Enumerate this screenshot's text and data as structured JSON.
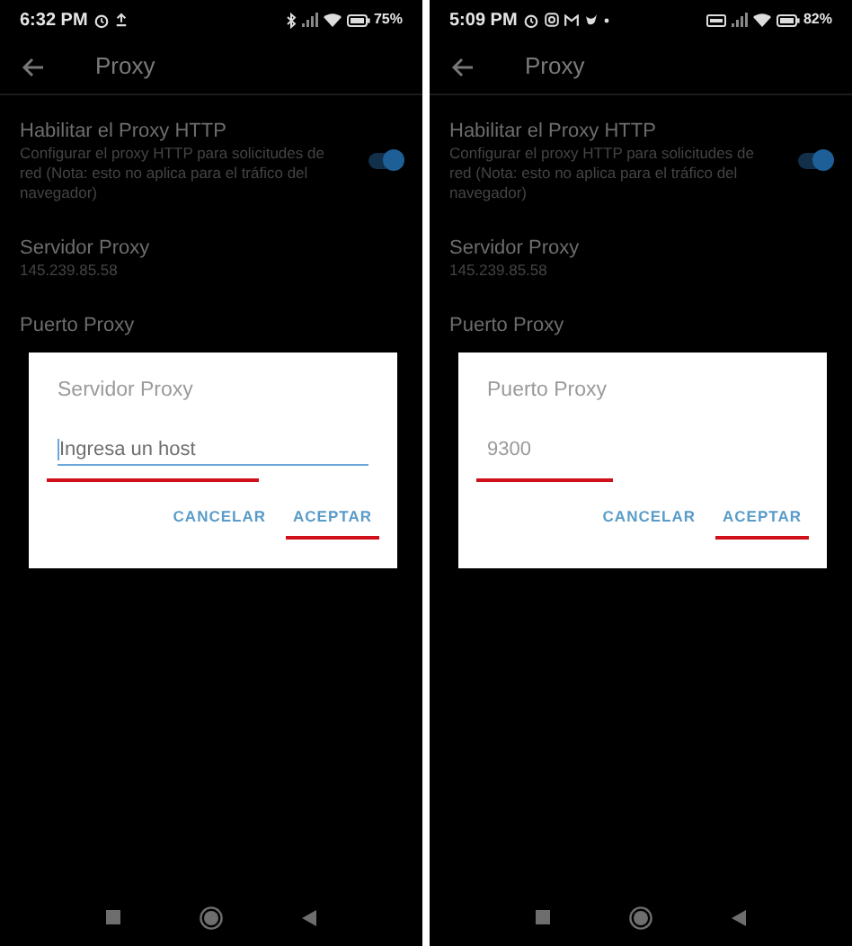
{
  "phones": [
    {
      "status_bar": {
        "time": "6:32 PM",
        "battery": "75%"
      },
      "app_bar": {
        "title": "Proxy"
      },
      "settings": [
        {
          "kind": "switch",
          "title": "Habilitar el Proxy HTTP",
          "summary": "Configurar el proxy HTTP para solicitudes de red (Nota: esto no aplica para el tráfico del navegador)",
          "on": true
        },
        {
          "kind": "text",
          "title": "Servidor Proxy",
          "summary": "145.239.85.58"
        },
        {
          "kind": "text",
          "title": "Puerto Proxy"
        }
      ],
      "dialog": {
        "title": "Servidor Proxy",
        "field": {
          "placeholder": "Ingresa un host",
          "focused": true
        },
        "buttons": [
          "CANCELAR",
          "ACEPTAR"
        ]
      }
    },
    {
      "status_bar": {
        "time": "5:09 PM",
        "battery": "82%"
      },
      "app_bar": {
        "title": "Proxy"
      },
      "settings": [
        {
          "kind": "switch",
          "title": "Habilitar el Proxy HTTP",
          "summary": "Configurar el proxy HTTP para solicitudes de red (Nota: esto no aplica para el tráfico del navegador)",
          "on": true
        },
        {
          "kind": "text",
          "title": "Servidor Proxy",
          "summary": "145.239.85.58"
        },
        {
          "kind": "text",
          "title": "Puerto Proxy"
        }
      ],
      "dialog": {
        "title": "Puerto Proxy",
        "field": {
          "placeholder": "9300",
          "focused": false
        },
        "buttons": [
          "CANCELAR",
          "ACEPTAR"
        ]
      }
    }
  ]
}
